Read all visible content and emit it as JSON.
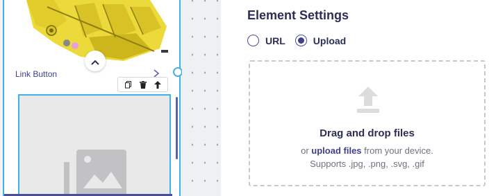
{
  "colors": {
    "accent": "#3e3f8f",
    "selection_outline": "#3fb2e6",
    "heading": "#2c2e55",
    "muted_text": "#6f7180"
  },
  "canvas": {
    "element_label": "Link Button",
    "link_chevron_icon": "chevron-right-icon",
    "collapse_icon": "chevron-up-icon",
    "toolbar": [
      {
        "icon": "copy-icon",
        "name": "duplicate-button"
      },
      {
        "icon": "trash-icon",
        "name": "delete-button"
      },
      {
        "icon": "arrow-up-icon",
        "name": "move-up-button"
      }
    ],
    "placeholder_icon": "image-placeholder-icon"
  },
  "settings": {
    "title": "Element Settings",
    "source_options": [
      {
        "label": "URL",
        "selected": false
      },
      {
        "label": "Upload",
        "selected": true
      }
    ],
    "dropzone": {
      "icon": "upload-icon",
      "title": "Drag and drop files",
      "prefix": "or ",
      "link_text": "upload files",
      "suffix": " from your device.",
      "formats": "Supports .jpg, .png, .svg, .gif"
    }
  }
}
